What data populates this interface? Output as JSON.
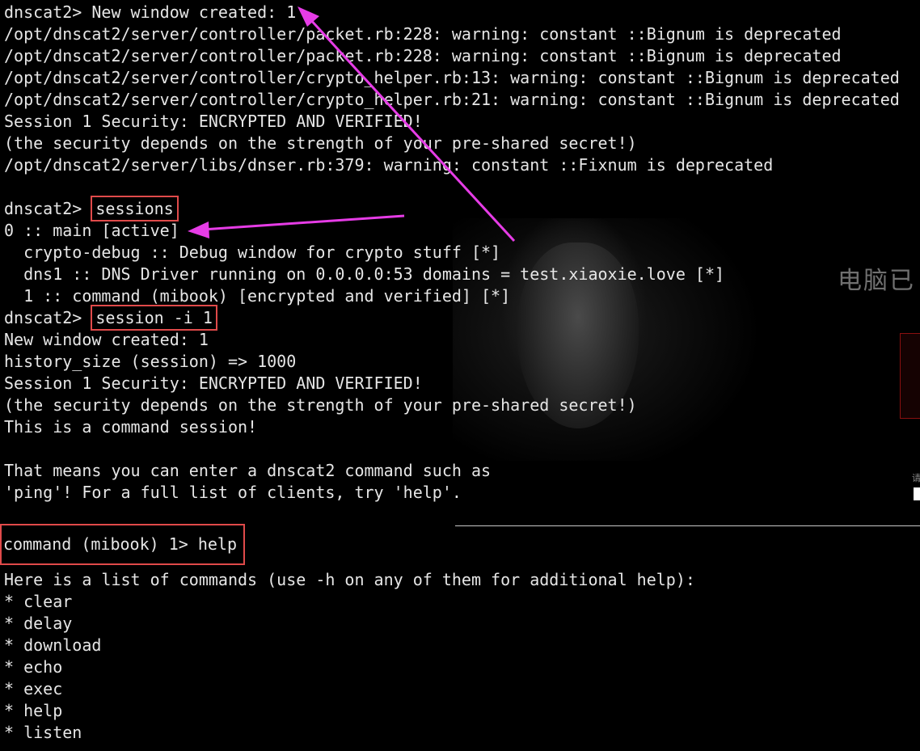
{
  "background": {
    "watermark_text": "电脑已",
    "small_char": "请"
  },
  "colors": {
    "terminal_bg": "#000000",
    "terminal_text": "#e6e6e6",
    "highlight_box": "#e04a4a",
    "arrow": "#e63ce6"
  },
  "terminal": {
    "lines": [
      {
        "prompt": "dnscat2> ",
        "text": "New window created: 1"
      },
      {
        "text": "/opt/dnscat2/server/controller/packet.rb:228: warning: constant ::Bignum is deprecated"
      },
      {
        "text": "/opt/dnscat2/server/controller/packet.rb:228: warning: constant ::Bignum is deprecated"
      },
      {
        "text": "/opt/dnscat2/server/controller/crypto_helper.rb:13: warning: constant ::Bignum is deprecated"
      },
      {
        "text": "/opt/dnscat2/server/controller/crypto_helper.rb:21: warning: constant ::Bignum is deprecated"
      },
      {
        "text": "Session 1 Security: ENCRYPTED AND VERIFIED!"
      },
      {
        "text": "(the security depends on the strength of your pre-shared secret!)"
      },
      {
        "text": "/opt/dnscat2/server/libs/dnser.rb:379: warning: constant ::Fixnum is deprecated"
      },
      {
        "text": ""
      },
      {
        "prompt": "dnscat2> ",
        "command": "sessions"
      },
      {
        "text": "0 :: main [active]"
      },
      {
        "text": "  crypto-debug :: Debug window for crypto stuff [*]"
      },
      {
        "text": "  dns1 :: DNS Driver running on 0.0.0.0:53 domains = test.xiaoxie.love [*]"
      },
      {
        "text": "  1 :: command (mibook) [encrypted and verified] [*]"
      },
      {
        "prompt": "dnscat2> ",
        "command": "session -i 1"
      },
      {
        "text": "New window created: 1"
      },
      {
        "text": "history_size (session) => 1000"
      },
      {
        "text": "Session 1 Security: ENCRYPTED AND VERIFIED!"
      },
      {
        "text": "(the security depends on the strength of your pre-shared secret!)"
      },
      {
        "text": "This is a command session!"
      },
      {
        "text": ""
      },
      {
        "text": "That means you can enter a dnscat2 command such as"
      },
      {
        "text": "'ping'! For a full list of clients, try 'help'."
      },
      {
        "text": ""
      },
      {
        "highlight_full": "command (mibook) 1> help"
      },
      {
        "text": ""
      },
      {
        "text": "Here is a list of commands (use -h on any of them for additional help):"
      },
      {
        "text": "* clear"
      },
      {
        "text": "* delay"
      },
      {
        "text": "* download"
      },
      {
        "text": "* echo"
      },
      {
        "text": "* exec"
      },
      {
        "text": "* help"
      },
      {
        "text": "* listen"
      }
    ]
  }
}
